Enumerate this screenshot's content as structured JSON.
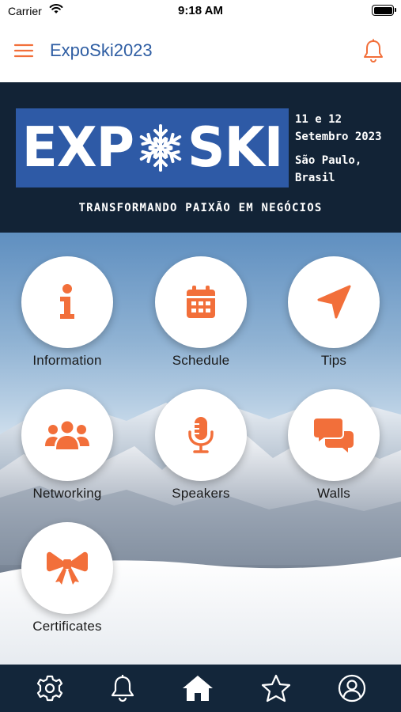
{
  "status_bar": {
    "carrier": "Carrier",
    "time": "9:18 AM"
  },
  "app_bar": {
    "title": "ExpoSki2023",
    "menu_icon": "hamburger-menu-icon",
    "bell_icon": "bell-icon"
  },
  "banner": {
    "logo_left": "EXP",
    "logo_right": "SKI",
    "logo_icon": "snowflake-icon",
    "date_line1": "11 e 12",
    "date_line2": "Setembro 2023",
    "location_line1": "São Paulo,",
    "location_line2": "Brasil",
    "tagline": "TRANSFORMANDO PAIXÃO EM NEGÓCIOS"
  },
  "menu": {
    "tiles": [
      {
        "label": "Information",
        "icon": "info-icon"
      },
      {
        "label": "Schedule",
        "icon": "calendar-icon"
      },
      {
        "label": "Tips",
        "icon": "location-arrow-icon"
      },
      {
        "label": "Networking",
        "icon": "people-group-icon"
      },
      {
        "label": "Speakers",
        "icon": "microphone-icon"
      },
      {
        "label": "Walls",
        "icon": "chat-bubbles-icon"
      },
      {
        "label": "Certificates",
        "icon": "ribbon-bow-icon"
      }
    ]
  },
  "tab_bar": {
    "items": [
      {
        "icon": "gear-icon"
      },
      {
        "icon": "bell-icon"
      },
      {
        "icon": "home-icon",
        "active": true
      },
      {
        "icon": "star-icon"
      },
      {
        "icon": "user-profile-icon"
      }
    ]
  },
  "colors": {
    "accent": "#f26f3a",
    "brand_blue": "#2e5aa6",
    "title_blue": "#2f5ea3",
    "navy": "#13263a"
  }
}
